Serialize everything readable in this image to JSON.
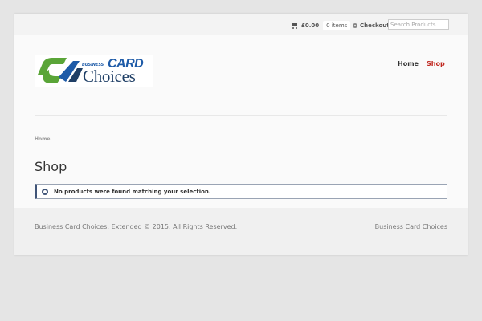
{
  "header": {
    "cart": {
      "total": "£0.00",
      "count": "0 items"
    },
    "checkout_label": "Checkout",
    "search_placeholder": "Search Products"
  },
  "logo": {
    "small_text": "BUSINESS",
    "card_text": "CARD",
    "choices_text": "Choices",
    "colors": {
      "green": "#5aa538",
      "blue": "#1e5ba8",
      "navy": "#1f3f66"
    }
  },
  "nav": {
    "items": [
      {
        "label": "Home",
        "active": false
      },
      {
        "label": "Shop",
        "active": true
      }
    ],
    "active_color": "#c0271f"
  },
  "breadcrumb": {
    "home": "Home"
  },
  "main": {
    "title": "Shop",
    "notice": "No products were found matching your selection."
  },
  "footer": {
    "copyright": "Business Card Choices: Extended © 2015. All Rights Reserved.",
    "site_name": "Business Card Choices"
  }
}
